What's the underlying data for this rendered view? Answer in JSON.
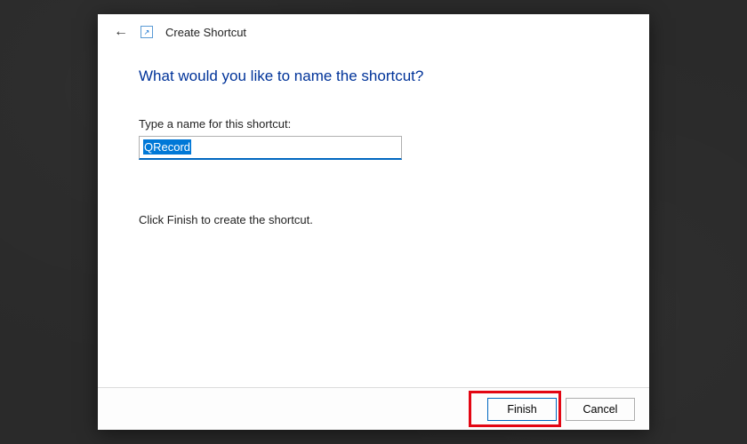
{
  "header": {
    "title": "Create Shortcut"
  },
  "main": {
    "heading": "What would you like to name the shortcut?",
    "field_label": "Type a name for this shortcut:",
    "input_value": "QRecord",
    "instruction": "Click Finish to create the shortcut."
  },
  "buttons": {
    "finish": "Finish",
    "cancel": "Cancel"
  }
}
